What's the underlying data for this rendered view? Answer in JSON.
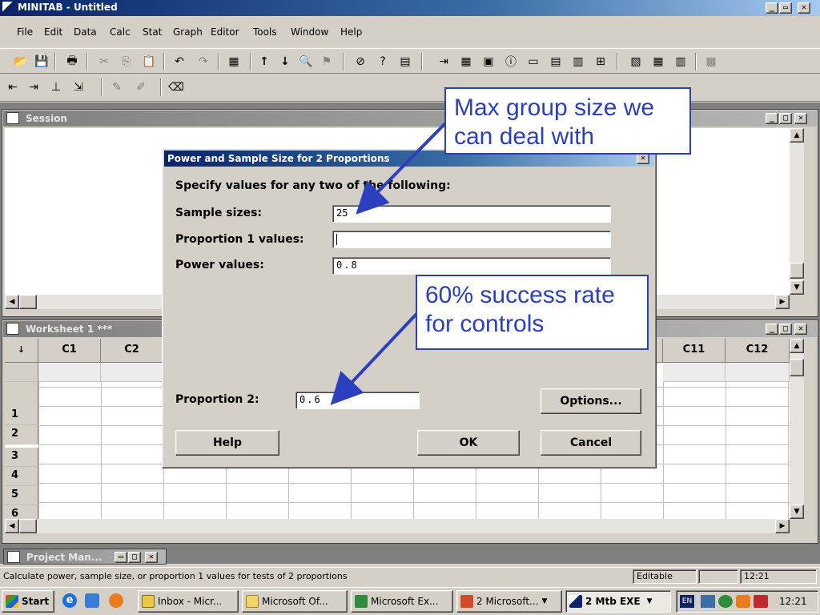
{
  "app": {
    "title": "MINITAB - Untitled",
    "menu": [
      "File",
      "Edit",
      "Data",
      "Calc",
      "Stat",
      "Graph",
      "Editor",
      "Tools",
      "Window",
      "Help"
    ]
  },
  "session": {
    "title": "Session"
  },
  "worksheet": {
    "title": "Worksheet 1 ***",
    "corner": "↓",
    "columns": [
      "C1",
      "C2",
      "C11",
      "C12"
    ],
    "rows": [
      "1",
      "2",
      "3",
      "4",
      "5",
      "6"
    ]
  },
  "dialog": {
    "title": "Power and Sample Size for 2 Proportions",
    "instruction": "Specify values for any two of the following:",
    "sample_sizes_label": "Sample sizes:",
    "sample_sizes_value": "25",
    "proportion1_label": "Proportion 1 values:",
    "proportion1_value": "",
    "power_label": "Power values:",
    "power_value": "0.8",
    "proportion2_label": "Proportion 2:",
    "proportion2_value": "0.6",
    "options_button": "Options...",
    "help_button": "Help",
    "ok_button": "OK",
    "cancel_button": "Cancel"
  },
  "callouts": {
    "group_size": "Max group size we can deal with",
    "success_rate": "60% success rate for controls"
  },
  "project_manager": {
    "title": "Project Man..."
  },
  "status_bar": {
    "message": "Calculate power, sample size, or proportion 1 values for tests of 2 proportions",
    "mode": "Editable",
    "time": "12:21"
  },
  "taskbar": {
    "start": "Start",
    "buttons": [
      "Inbox - Micr...",
      "Microsoft Of...",
      "Microsoft Ex...",
      "2 Microsoft...",
      "2 Mtb EXE"
    ],
    "lang": "EN",
    "clock": "12:21"
  },
  "colors": {
    "accent": "#0a246a",
    "callout": "#2c3fbf",
    "desktop": "#d4d0c8"
  }
}
